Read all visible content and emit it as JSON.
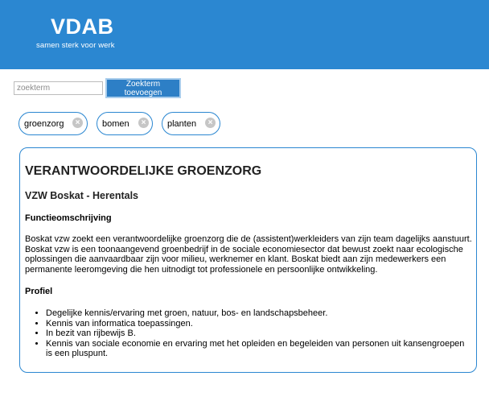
{
  "header": {
    "logo_text": "VDAB",
    "tagline": "samen sterk voor werk",
    "background": "#2b87d1"
  },
  "search": {
    "placeholder": "zoekterm",
    "value": "",
    "add_button_label": "Zoekterm toevoegen"
  },
  "tags": [
    {
      "label": "groenzorg",
      "remove_icon": "close-circle-icon"
    },
    {
      "label": "bomen",
      "remove_icon": "close-circle-icon"
    },
    {
      "label": "planten",
      "remove_icon": "close-circle-icon"
    }
  ],
  "job": {
    "title": "VERANTWOORDELIJKE GROENZORG",
    "company": "VZW Boskat - Herentals",
    "description_heading": "Functieomschrijving",
    "description": "Boskat vzw zoekt een verantwoordelijke groenzorg die de (assistent)werkleiders van zijn team dagelijks aanstuurt. Boskat vzw is een toonaangevend groenbedrijf in de sociale economiesector dat bewust zoekt naar ecologische oplossingen die aanvaardbaar zijn voor milieu, werknemer en klant. Boskat biedt aan zijn medewerkers een permanente leeromgeving die hen uitnodigt tot professionele en persoonlijke ontwikkeling.",
    "profile_heading": "Profiel",
    "profile_items": [
      "Degelijke kennis/ervaring met groen, natuur, bos- en landschapsbeheer.",
      "Kennis van informatica toepassingen.",
      "In bezit van rijbewijs B.",
      "Kennis van sociale economie en ervaring met het opleiden en begeleiden van personen uit kansengroepen is een pluspunt."
    ]
  }
}
